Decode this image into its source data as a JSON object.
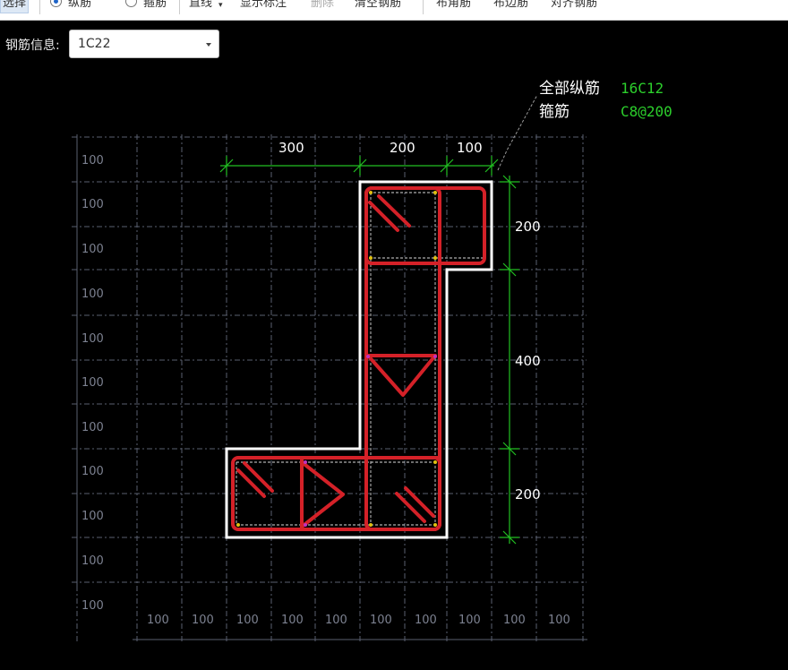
{
  "toolbar": {
    "items": [
      {
        "label": "选择",
        "state": "selected"
      },
      {
        "label": "纵筋",
        "radio": true,
        "checked": true
      },
      {
        "label": "箍筋",
        "radio": true,
        "checked": false
      },
      {
        "label": "直线",
        "dropdown": true
      },
      {
        "label": "显示标注"
      },
      {
        "label": "删除",
        "state": "disabled"
      },
      {
        "label": "清空钢筋"
      },
      {
        "label": "布角筋"
      },
      {
        "label": "布边筋"
      },
      {
        "label": "对齐钢筋"
      }
    ]
  },
  "rebar_info": {
    "label": "钢筋信息:",
    "value": "1C22"
  },
  "drawing": {
    "summary": [
      {
        "label": "全部纵筋",
        "value": "16C12"
      },
      {
        "label": "箍筋",
        "value": "C8@200"
      }
    ],
    "dims_top": [
      "300",
      "200",
      "100"
    ],
    "dims_right": [
      "200",
      "400",
      "200"
    ],
    "grid_left": [
      "100",
      "100",
      "100",
      "100",
      "100",
      "100",
      "100",
      "100",
      "100",
      "100",
      "100"
    ],
    "grid_bottom": [
      "100",
      "100",
      "100",
      "100",
      "100",
      "100",
      "100",
      "100",
      "100",
      "100"
    ],
    "colors": {
      "background": "#000000",
      "grid": "#5a6070",
      "outline": "#ffffff",
      "rebar": "#d42128",
      "dimension": "#22c022",
      "value_text": "#2ccf2c"
    }
  }
}
